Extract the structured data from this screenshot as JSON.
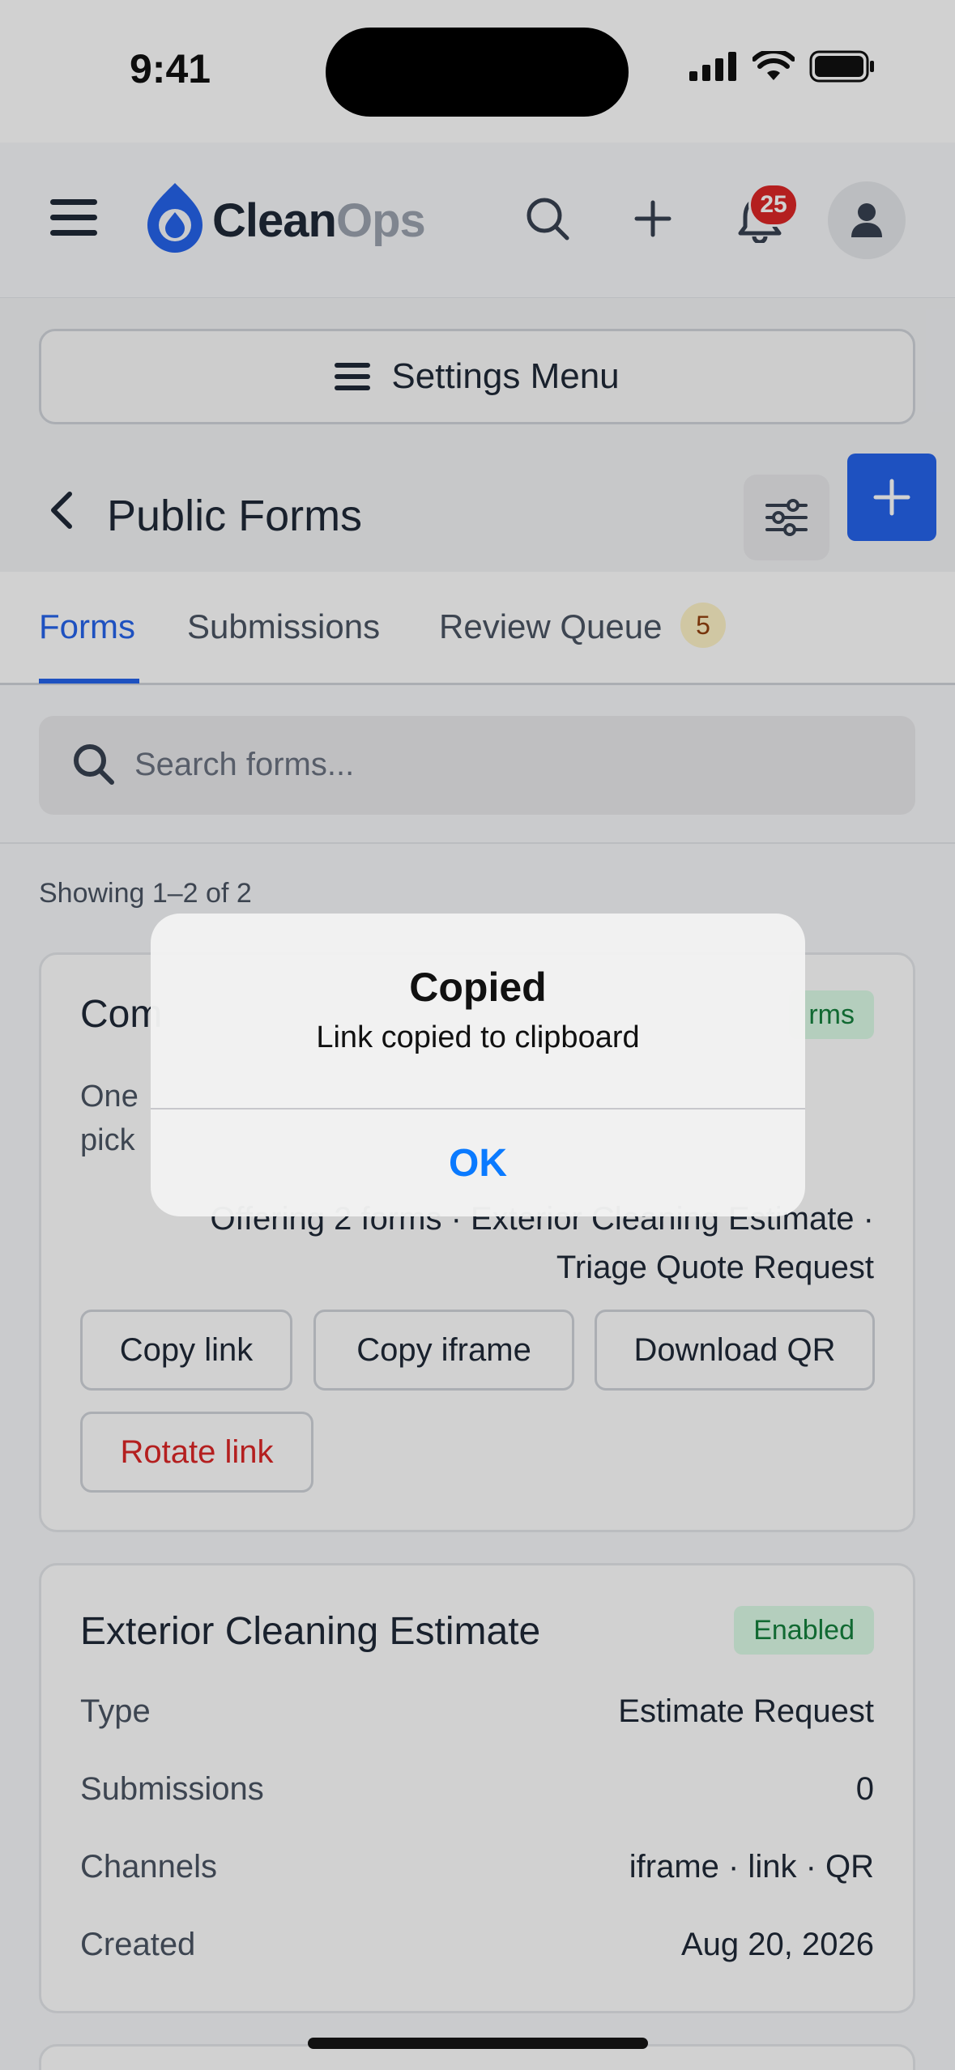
{
  "status_bar": {
    "time": "9:41"
  },
  "header": {
    "logo_clean": "Clean",
    "logo_ops": "Ops",
    "notification_count": "25",
    "icons": [
      "menu-icon",
      "search-icon",
      "plus-icon",
      "bell-icon",
      "user-icon"
    ]
  },
  "settings": {
    "label": "Settings Menu"
  },
  "page": {
    "title": "Public Forms"
  },
  "tabs": [
    {
      "label": "Forms",
      "active": true
    },
    {
      "label": "Submissions",
      "active": false
    },
    {
      "label": "Review Queue",
      "active": false,
      "count": "5"
    }
  ],
  "search": {
    "placeholder": "Search forms..."
  },
  "list": {
    "showing": "Showing 1–2 of 2"
  },
  "card1": {
    "title": "Com",
    "badge": "rms",
    "desc_line1": "One",
    "desc_line2": "pick",
    "offering_line1": "Offering 2 forms · Exterior Cleaning Estimate ·",
    "offering_line2": "Triage Quote Request",
    "buttons": {
      "copy_link": "Copy link",
      "copy_iframe": "Copy iframe",
      "download_qr": "Download QR",
      "rotate_link": "Rotate link"
    }
  },
  "card2": {
    "title": "Exterior Cleaning Estimate",
    "badge": "Enabled",
    "rows": [
      {
        "label": "Type",
        "value": "Estimate Request"
      },
      {
        "label": "Submissions",
        "value": "0"
      },
      {
        "label": "Channels",
        "value": "iframe · link · QR"
      },
      {
        "label": "Created",
        "value": "Aug 20, 2026"
      }
    ]
  },
  "alert": {
    "title": "Copied",
    "message": "Link copied to clipboard",
    "ok_label": "OK"
  },
  "colors": {
    "accent": "#2563eb",
    "danger": "#dc2626",
    "success_bg": "#dcfce7",
    "success_text": "#15803d",
    "ios_blue": "#0a7aff"
  }
}
